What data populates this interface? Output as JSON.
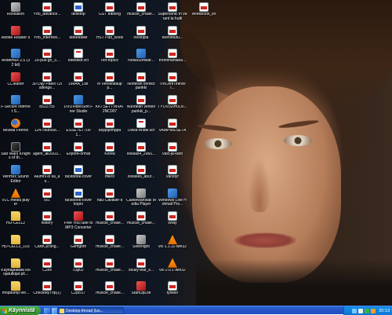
{
  "taskbar": {
    "start_label": "Käynnistä",
    "window_label": "Desktop-thread (lus...",
    "clock": "20:13",
    "quicklaunch": [
      "ie-icon",
      "desktop-icon",
      "media-icon"
    ],
    "tray": [
      "network-icon",
      "volume-icon",
      "shield-icon",
      "messenger-icon"
    ]
  },
  "icons": [
    {
      "label": "Roskakori",
      "icon": "recycle-bin-icon",
      "glyph": "g-gray"
    },
    {
      "label": "Adobe Reader 9",
      "icon": "acrobat-icon",
      "glyph": "g-red"
    },
    {
      "label": "Avidemux 2.5 (32 bit)",
      "icon": "avidemux-icon",
      "glyph": "g-app"
    },
    {
      "label": "CCleaner",
      "icon": "ccleaner-icon",
      "glyph": "g-red"
    },
    {
      "label": "F-Secure Internet S...",
      "icon": "fsecure-icon",
      "glyph": "g-app"
    },
    {
      "label": "Mozilla Firefox",
      "icon": "firefox-icon",
      "glyph": "g-firefox"
    },
    {
      "label": "Star Wars Knights of th...",
      "icon": "game-icon",
      "glyph": "g-dark"
    },
    {
      "label": "WinHex Sound Editor",
      "icon": "sound-editor-icon",
      "glyph": "g-app"
    },
    {
      "label": "VLC media player",
      "icon": "vlc-icon",
      "glyph": "g-cone"
    },
    {
      "label": "HD-CELL2",
      "icon": "folder-icon",
      "glyph": "g-folder"
    },
    {
      "label": "HD-CELL2_103",
      "icon": "folder-icon",
      "glyph": "g-folder"
    },
    {
      "label": "Käyttäjätilalla kolojatutkijat pit...",
      "icon": "folder-icon",
      "glyph": "g-folder"
    },
    {
      "label": "mopdump-vie...",
      "icon": "folder-icon",
      "glyph": "g-folder"
    },
    {
      "label": "Yrt5_advance...",
      "icon": "document-icon",
      "glyph": "g-pdf"
    },
    {
      "label": "Yrt5_interned...",
      "icon": "document-icon",
      "glyph": "g-pdf"
    },
    {
      "label": "29-pull-go_3...",
      "icon": "document-icon",
      "glyph": "g-pdf"
    },
    {
      "label": "30 Day Paleo Challenge...",
      "icon": "document-icon",
      "glyph": "g-pdf"
    },
    {
      "label": "8522755",
      "icon": "document-icon",
      "glyph": "g-pdf"
    },
    {
      "label": "1247968068...",
      "icon": "document-icon",
      "glyph": "g-pdf"
    },
    {
      "label": "agent_ak2003...",
      "icon": "document-icon",
      "glyph": "g-pdf"
    },
    {
      "label": "Alumni ei sa_as...",
      "icon": "document-icon",
      "glyph": "g-pdf"
    },
    {
      "label": "5c1",
      "icon": "document-icon",
      "glyph": "g-pdf"
    },
    {
      "label": "history",
      "icon": "document-icon",
      "glyph": "g-pdf"
    },
    {
      "label": "CarbCycling...",
      "icon": "document-icon",
      "glyph": "g-pdf"
    },
    {
      "label": "C2es",
      "icon": "document-icon",
      "glyph": "g-pdf"
    },
    {
      "label": "CheckMyTrip(1)",
      "icon": "document-icon",
      "glyph": "g-pdf"
    },
    {
      "label": "desktop",
      "icon": "document-icon",
      "glyph": "g-blue-doc"
    },
    {
      "label": "8beet8bkit",
      "icon": "document-icon",
      "glyph": "g-pdf"
    },
    {
      "label": "dieet8kit.vcf",
      "icon": "document-icon",
      "glyph": "g-doc"
    },
    {
      "label": "DMAA_List",
      "icon": "document-icon",
      "glyph": "g-pdf"
    },
    {
      "label": "DVDVideoSoft Free Studio",
      "icon": "dvdvideosoft-icon",
      "glyph": "g-app"
    },
    {
      "label": "ESSETET7001...",
      "icon": "document-icon",
      "glyph": "g-pdf"
    },
    {
      "label": "ExportFormat",
      "icon": "document-icon",
      "glyph": "g-pdf"
    },
    {
      "label": "facebook-cover",
      "icon": "document-icon",
      "glyph": "g-blue-doc"
    },
    {
      "label": "facebook-cover kopio",
      "icon": "document-icon",
      "glyph": "g-blue-doc"
    },
    {
      "label": "Free YouTube to MP3 Converter",
      "icon": "youtube-mp3-icon",
      "glyph": "g-red"
    },
    {
      "label": "Gsmgoth",
      "icon": "document-icon",
      "glyph": "g-pdf"
    },
    {
      "label": "c3p02",
      "icon": "document-icon",
      "glyph": "g-pdf"
    },
    {
      "label": "C2pci17",
      "icon": "document-icon",
      "glyph": "g-pdf"
    },
    {
      "label": "GST training",
      "icon": "document-icon",
      "glyph": "g-pdf"
    },
    {
      "label": "HST Pdd_Book",
      "icon": "document-icon",
      "glyph": "g-pdf"
    },
    {
      "label": "hot-topics",
      "icon": "document-icon",
      "glyph": "g-pdf"
    },
    {
      "label": "in Verkkokaupp...",
      "icon": "document-icon",
      "glyph": "g-pdf"
    },
    {
      "label": "KKTSETTINVAT 2NC007",
      "icon": "document-icon",
      "glyph": "g-pdf"
    },
    {
      "label": "keppijomppa",
      "icon": "document-icon",
      "glyph": "g-pdf"
    },
    {
      "label": "Korea",
      "icon": "document-icon",
      "glyph": "g-pdf"
    },
    {
      "label": "mikro",
      "icon": "document-icon",
      "glyph": "g-pdf"
    },
    {
      "label": "nau-Cavalier-it",
      "icon": "document-icon",
      "glyph": "g-pdf"
    },
    {
      "label": "muscle_challe...",
      "icon": "document-icon",
      "glyph": "g-pdf"
    },
    {
      "label": "muscle_challe...",
      "icon": "document-icon",
      "glyph": "g-pdf"
    },
    {
      "label": "muscle_challe...",
      "icon": "document-icon",
      "glyph": "g-pdf"
    },
    {
      "label": "muscle_challe...",
      "icon": "document-icon",
      "glyph": "g-pdf"
    },
    {
      "label": "muscle_challe...",
      "icon": "document-icon",
      "glyph": "g-pdf"
    },
    {
      "label": "nextopia",
      "icon": "document-icon",
      "glyph": "g-pdf"
    },
    {
      "label": "NokiaSoftwar...",
      "icon": "nokia-icon",
      "glyph": "g-app"
    },
    {
      "label": "Nordean verkkopankki",
      "icon": "document-icon",
      "glyph": "g-pdf"
    },
    {
      "label": "Nuodean verkkopankki_p...",
      "icon": "document-icon",
      "glyph": "g-pdf"
    },
    {
      "label": "Olivia-Wilde.scf",
      "icon": "document-icon",
      "glyph": "g-doc"
    },
    {
      "label": "olivaas4_2966...",
      "icon": "document-icon",
      "glyph": "g-pdf"
    },
    {
      "label": "olivasell_a80r...",
      "icon": "document-icon",
      "glyph": "g-pdf"
    },
    {
      "label": "Castlewanstall Media Player",
      "icon": "media-player-icon",
      "glyph": "g-gray"
    },
    {
      "label": "muscle_challe...",
      "icon": "document-icon",
      "glyph": "g-pdf"
    },
    {
      "label": "Silverlight",
      "icon": "silverlight-icon",
      "glyph": "g-gray"
    },
    {
      "label": "soully-war_s...",
      "icon": "document-icon",
      "glyph": "g-pdf"
    },
    {
      "label": "StartUpLite",
      "icon": "startuplite-icon",
      "glyph": "g-red"
    },
    {
      "label": "Supersonic in varant la hutti",
      "icon": "document-icon",
      "glyph": "g-pdf"
    },
    {
      "label": "teenintutu...",
      "icon": "document-icon",
      "glyph": "g-pdf"
    },
    {
      "label": "treeninahiaea...",
      "icon": "document-icon",
      "glyph": "g-pdf"
    },
    {
      "label": "TreCertiTelevisi...",
      "icon": "document-icon",
      "glyph": "g-pdf"
    },
    {
      "label": "TYOV02IH0D0...",
      "icon": "document-icon",
      "glyph": "g-pdf"
    },
    {
      "label": "VAMPIRESETA",
      "icon": "document-icon",
      "glyph": "g-pdf"
    },
    {
      "label": "vaxt-ja-kard",
      "icon": "document-icon",
      "glyph": "g-pdf"
    },
    {
      "label": "vanstyr",
      "icon": "document-icon",
      "glyph": "g-pdf"
    },
    {
      "label": "Windows Live Hotmail Pro...",
      "icon": "hotmail-icon",
      "glyph": "g-app"
    },
    {
      "label": "Wfay",
      "icon": "document-icon",
      "glyph": "g-pdf"
    },
    {
      "label": "vlc-1.1.11-win32",
      "icon": "vlc-icon",
      "glyph": "g-cone"
    },
    {
      "label": "vlc-2.0.1-win32",
      "icon": "vlc-icon",
      "glyph": "g-cone"
    },
    {
      "label": "tyokko",
      "icon": "document-icon",
      "glyph": "g-pdf"
    },
    {
      "label": "WorkBook_ex",
      "icon": "document-icon",
      "glyph": "g-pdf"
    }
  ]
}
